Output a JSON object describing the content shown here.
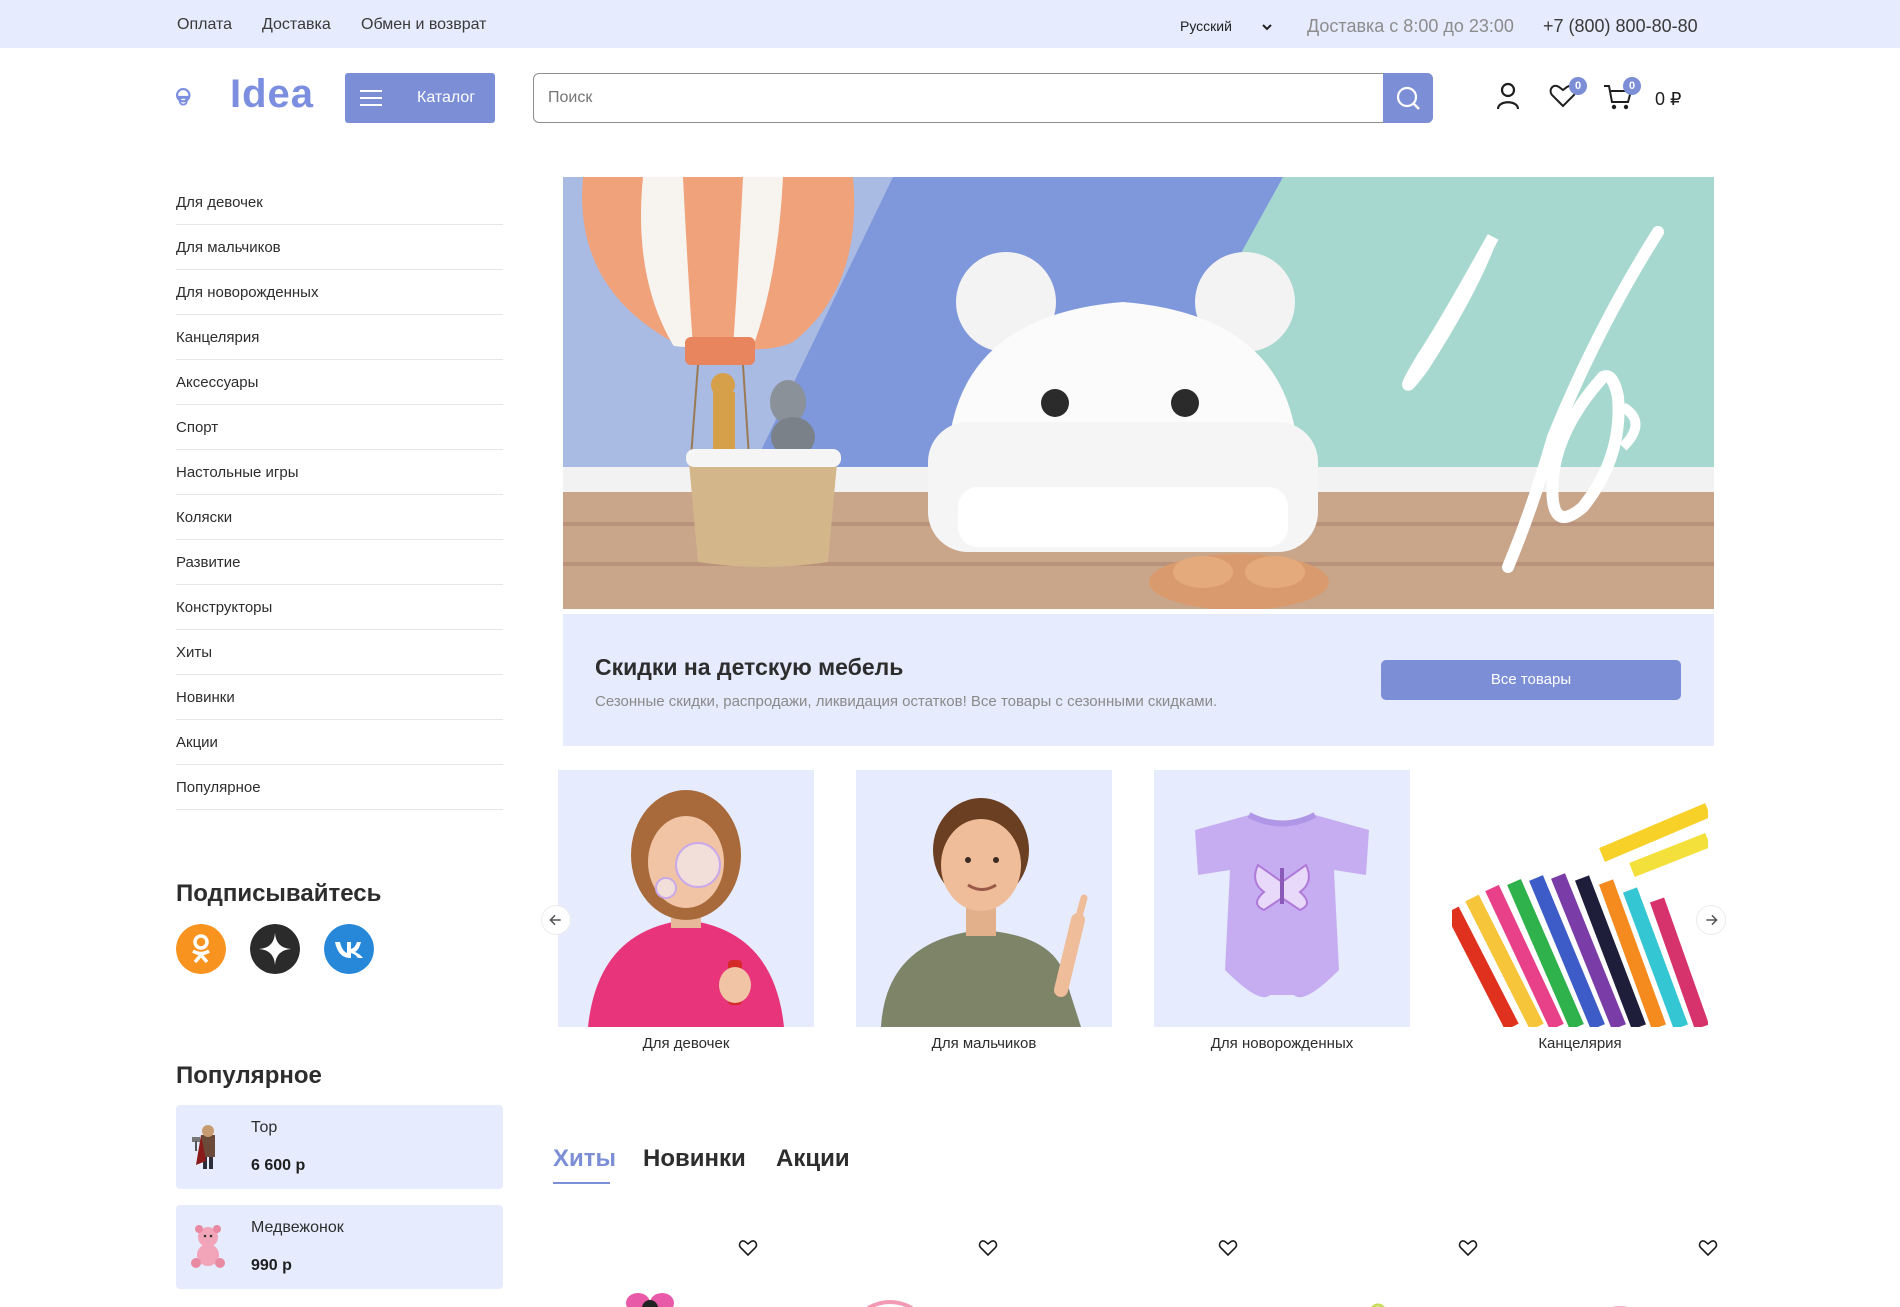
{
  "topbar": {
    "links": [
      "Оплата",
      "Доставка",
      "Обмен и возврат"
    ],
    "language": "Русский",
    "delivery": "Доставка с 8:00 до 23:00",
    "phone": "+7 (800) 800-80-80"
  },
  "header": {
    "logo": "Idea",
    "catalog": "Каталог",
    "search_placeholder": "Поиск",
    "favorites_count": "0",
    "cart_count": "0",
    "cart_sum": "0 ₽"
  },
  "sidebar": {
    "items": [
      "Для девочек",
      "Для мальчиков",
      "Для новорожденных",
      "Канцелярия",
      "Аксессуары",
      "Спорт",
      "Настольные игры",
      "Коляски",
      "Развитие",
      "Конструкторы",
      "Хиты",
      "Новинки",
      "Акции",
      "Популярное"
    ],
    "subscribe_title": "Подписывайтесь",
    "popular_title": "Популярное",
    "popular": [
      {
        "name": "Тор",
        "price": "6 600 р"
      },
      {
        "name": "Медвежонок",
        "price": "990 р"
      }
    ]
  },
  "promo": {
    "title": "Скидки на детскую мебель",
    "subtitle": "Сезонные скидки, распродажи, ликвидация остатков! Все товары с сезонными скидками.",
    "button": "Все товары"
  },
  "categories": [
    "Для девочек",
    "Для мальчиков",
    "Для новорожденных",
    "Канцелярия"
  ],
  "tabs": [
    "Хиты",
    "Новинки",
    "Акции"
  ],
  "colors": {
    "accent": "#7b8ed6",
    "light": "#e6ebfd",
    "ok": "#f7931e",
    "zen": "#2b2b2b",
    "vk": "#2787d9"
  }
}
